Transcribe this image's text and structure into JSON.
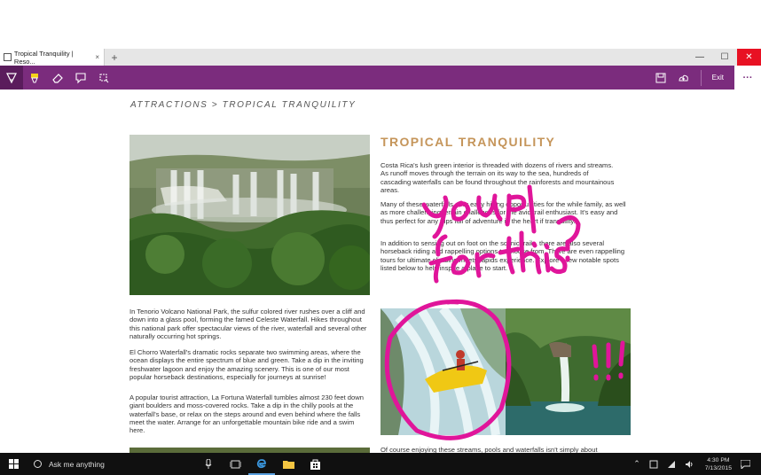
{
  "browser": {
    "tab_title": "Tropical Tranquility | Reso...",
    "tab_close": "×",
    "new_tab": "+",
    "window": {
      "minimize": "—",
      "maximize": "☐",
      "close": "✕"
    }
  },
  "note_toolbar": {
    "exit_label": "Exit",
    "more_label": "···",
    "accent_color": "#7b2c7d"
  },
  "page": {
    "breadcrumb": "ATTRACTIONS > TROPICAL TRANQUILITY",
    "title": "TROPICAL TRANQUILITY",
    "right_paragraphs": [
      "Costa Rica's lush green interior is threaded with dozens of rivers and streams. As runoff moves through the terrain on its way to the sea, hundreds of cascading waterfalls can be found throughout the rainforests and mountainous areas.",
      "Many of these waterfalls offer easy hiking opportunities for the while family, as well as more challenging terrain challenges for the avid trail enthusiast. It's easy and thus perfect for any trips full of adventure in the heart if tranquility.",
      "In addition to sensing out on foot on the scenic trails, there are also several horseback riding and rappelling options to choose from. There are even rappelling tours for ultimate climbing meets rapids experience. Explore a few notable spots listed below to help inspire a place to start."
    ],
    "left_paragraphs": [
      "In Tenorio Volcano National Park, the sulfur colored river rushes over a cliff and down into a glass pool, forming the famed Celeste Waterfall. Hikes throughout this national park offer spectacular views of the river, waterfall and several other naturally occurring hot springs.",
      "El Chorro Waterfall's dramatic rocks separate two swimming areas, where the ocean displays the entire spectrum of blue and green. Take a dip in the inviting freshwater lagoon and enjoy the amazing scenery. This is one of our most popular horseback destinations, especially for journeys at sunrise!",
      "A popular tourist attraction, La Fortuna Waterfall tumbles almost 230 feet down giant boulders and moss-covered rocks. Take a dip in the chilly pools at the waterfall's base, or relax on the steps around and even behind where the falls meet the water. Arrange for an unforgettable mountain bike ride and a swim here."
    ],
    "bottom_text": "Of course enjoying these streams, pools and waterfalls isn't simply about"
  },
  "annotation": {
    "line1": "You up",
    "line2": "for this?",
    "exclaim": "!!!",
    "ink_color": "#e0159a"
  },
  "taskbar": {
    "search_placeholder": "Ask me anything",
    "time": "4:30 PM",
    "date": "7/13/2015"
  }
}
